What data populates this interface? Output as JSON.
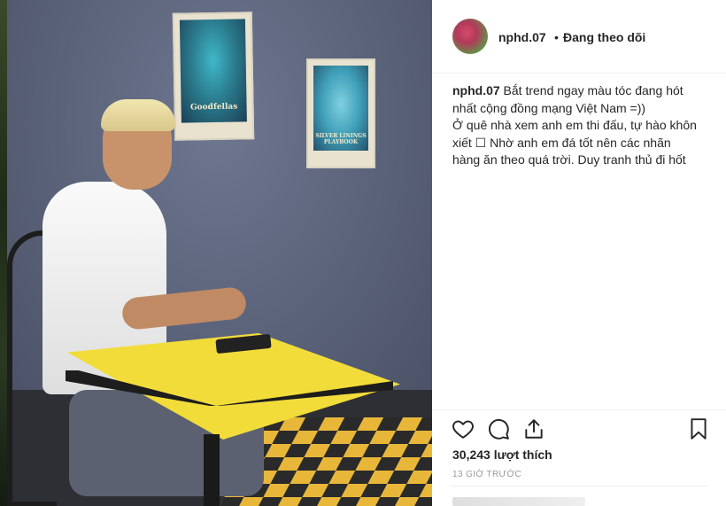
{
  "post": {
    "username": "nphd.07",
    "separator": "•",
    "follow_status": "Đang theo dõi",
    "caption_username": "nphd.07",
    "caption_line1": " Bắt trend ngay màu tóc đang hót",
    "caption_line2": "nhất cộng đồng mạng Việt Nam =))",
    "caption_line3": "Ở quê nhà xem anh em thi đấu, tự hào khôn",
    "caption_line4": "xiết ☐ Nhờ anh em đá tốt nên các nhãn",
    "caption_line5": "hàng ăn theo quá trời. Duy tranh thủ đi hốt",
    "likes": "30,243 lượt thích",
    "time_ago": "13 GIỜ TRƯỚC"
  },
  "photo": {
    "poster1_text": "Goodfellas",
    "poster2_text": "SILVER LININGS PLAYBOOK"
  },
  "icons": {
    "like": "heart-icon",
    "comment": "comment-icon",
    "share": "share-icon",
    "save": "bookmark-icon"
  },
  "colors": {
    "text": "#262626",
    "muted": "#999999",
    "border": "#efefef",
    "table_yellow": "#f2dc3a"
  }
}
